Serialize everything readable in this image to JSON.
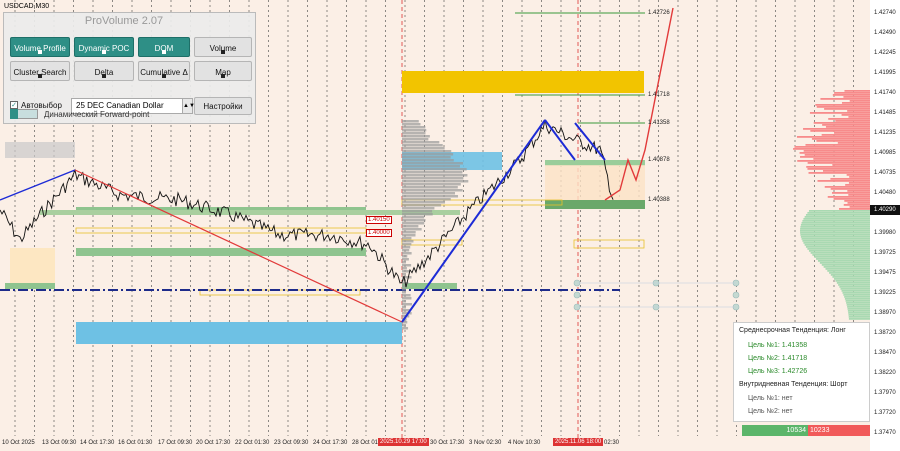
{
  "symbol": "USDCAD,M30",
  "panel": {
    "title": "ProVolume 2.07",
    "buttons": {
      "volume_profile": "Volume Profile",
      "dynamic_poc": "Dynamic POC",
      "dom": "DOM",
      "volume": "Volume",
      "cluster_search": "Cluster Search",
      "delta": "Delta",
      "cumulative_delta": "Cumulative Δ",
      "map": "Map",
      "settings": "Настройки"
    },
    "auto_select_label": "Автовыбор",
    "auto_select_checked": true,
    "instrument": "25 DEC Canadian Dollar",
    "forward_point_label": "Динамический Forward-point"
  },
  "price_axis": [
    "1.42740",
    "1.42490",
    "1.42245",
    "1.41995",
    "1.41740",
    "1.41485",
    "1.41235",
    "1.40985",
    "1.40735",
    "1.40480",
    "1.40290",
    "1.39980",
    "1.39725",
    "1.39475",
    "1.39225",
    "1.38970",
    "1.38720",
    "1.38470",
    "1.38220",
    "1.37970",
    "1.37720",
    "1.37470"
  ],
  "current_price": "1.40290",
  "time_axis": [
    "10 Oct 2025",
    "13 Oct 09:30",
    "14 Oct 17:30",
    "16 Oct 01:30",
    "17 Oct 09:30",
    "20 Oct 17:30",
    "22 Oct 01:30",
    "23 Oct 09:30",
    "24 Oct 17:30",
    "28 Oct 01:30",
    "30 Oct 17:30",
    "3 Nov 02:30",
    "4 Nov 10:30",
    "02:30"
  ],
  "time_highlights": [
    "2025.10.29 17:00",
    "2025.11.06 18:00"
  ],
  "level_labels": {
    "l1": "1.42726",
    "l2": "1.41718",
    "l3": "1.41358",
    "l4": "1.40878",
    "l5": "1.40388",
    "box1": "1.40150",
    "box2": "1.40000"
  },
  "trend": {
    "medium_title": "Среднесрочная Тенденция: Лонг",
    "target1": "Цель №1:  1.41358",
    "target2": "Цель №2:  1.41718",
    "target3": "Цель №3:  1.42726",
    "intraday_title": "Внутридневная Тенденция: Шорт",
    "intraday_target1": "Цель №1:  нет",
    "intraday_target2": "Цель №2:  нет"
  },
  "volume_split": {
    "buy": "10534",
    "sell": "10233"
  },
  "colors": {
    "teal": "#2e8f86",
    "up_red": "#e23a3a",
    "down_blue": "#1d2bd6",
    "gold": "#f2c400",
    "bull_green": "#3a9a3a"
  }
}
